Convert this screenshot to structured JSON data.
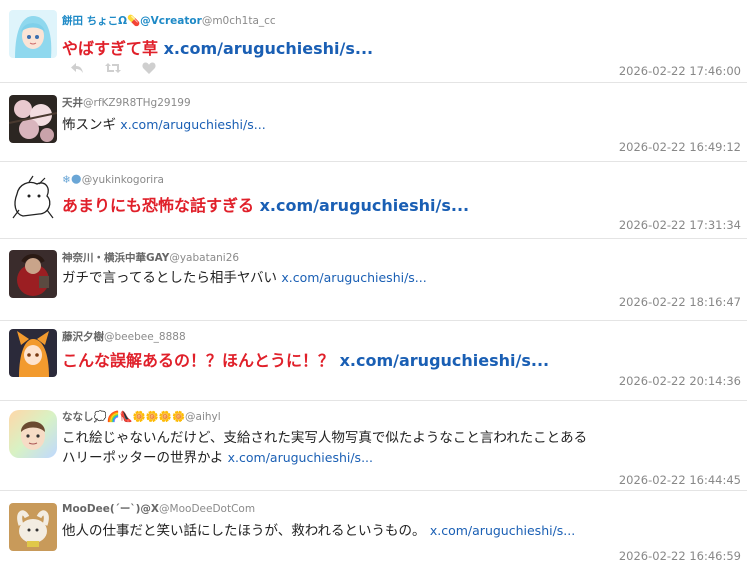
{
  "tweets": [
    {
      "name": "餅田 ちょこΩ💊@Vcreator",
      "handle": "@m0ch1ta_cc",
      "text": "やばすぎて草",
      "link": "x.com/aruguchieshi/s...",
      "time": "2026-02-22 17:46:00"
    },
    {
      "name": "天井",
      "handle": "@rfKZ9R8THg29199",
      "text": "怖スンギ",
      "link": "x.com/aruguchieshi/s...",
      "time": "2026-02-22 16:49:12"
    },
    {
      "name": "❄🌑",
      "handle": "@yukinkogorira",
      "text": "あまりにも恐怖な話すぎる",
      "link": "x.com/aruguchieshi/s...",
      "time": "2026-02-22 17:31:34"
    },
    {
      "name": "神奈川・横浜中華GAY",
      "handle": "@yabatani26",
      "text": "ガチで言ってるとしたら相手ヤバい",
      "link": "x.com/aruguchieshi/s...",
      "time": "2026-02-22 18:16:47"
    },
    {
      "name": "藤沢夕樹",
      "handle": "@beebee_8888",
      "text": "こんな誤解あるの！？ほんとうに！？",
      "link": "x.com/aruguchieshi/s...",
      "time": "2026-02-22 20:14:36"
    },
    {
      "name": "ななし💭🌈👠🌼🌼🌼🌼",
      "handle": "@aihyl",
      "text": "これ絵じゃないんだけど、支給された実写人物写真で似たようなこと言われたことある",
      "text2": "ハリーポッターの世界かよ",
      "link": "x.com/aruguchieshi/s...",
      "time": "2026-02-22 16:44:45"
    },
    {
      "name": "MooDee(´ー`)@X",
      "handle": "@MooDeeDotCom",
      "text": "他人の仕事だと笑い話にしたほうが、救われるというもの。",
      "link": "x.com/aruguchieshi/s...",
      "time": "2026-02-22 16:46:59"
    }
  ],
  "icons": [
    "reply-icon",
    "retweet-icon",
    "like-icon"
  ],
  "colors": {
    "highlight_text": "#e0202a",
    "link": "#1a5fb4",
    "timestamp": "#888888",
    "name_blue": "#1d89c6"
  }
}
